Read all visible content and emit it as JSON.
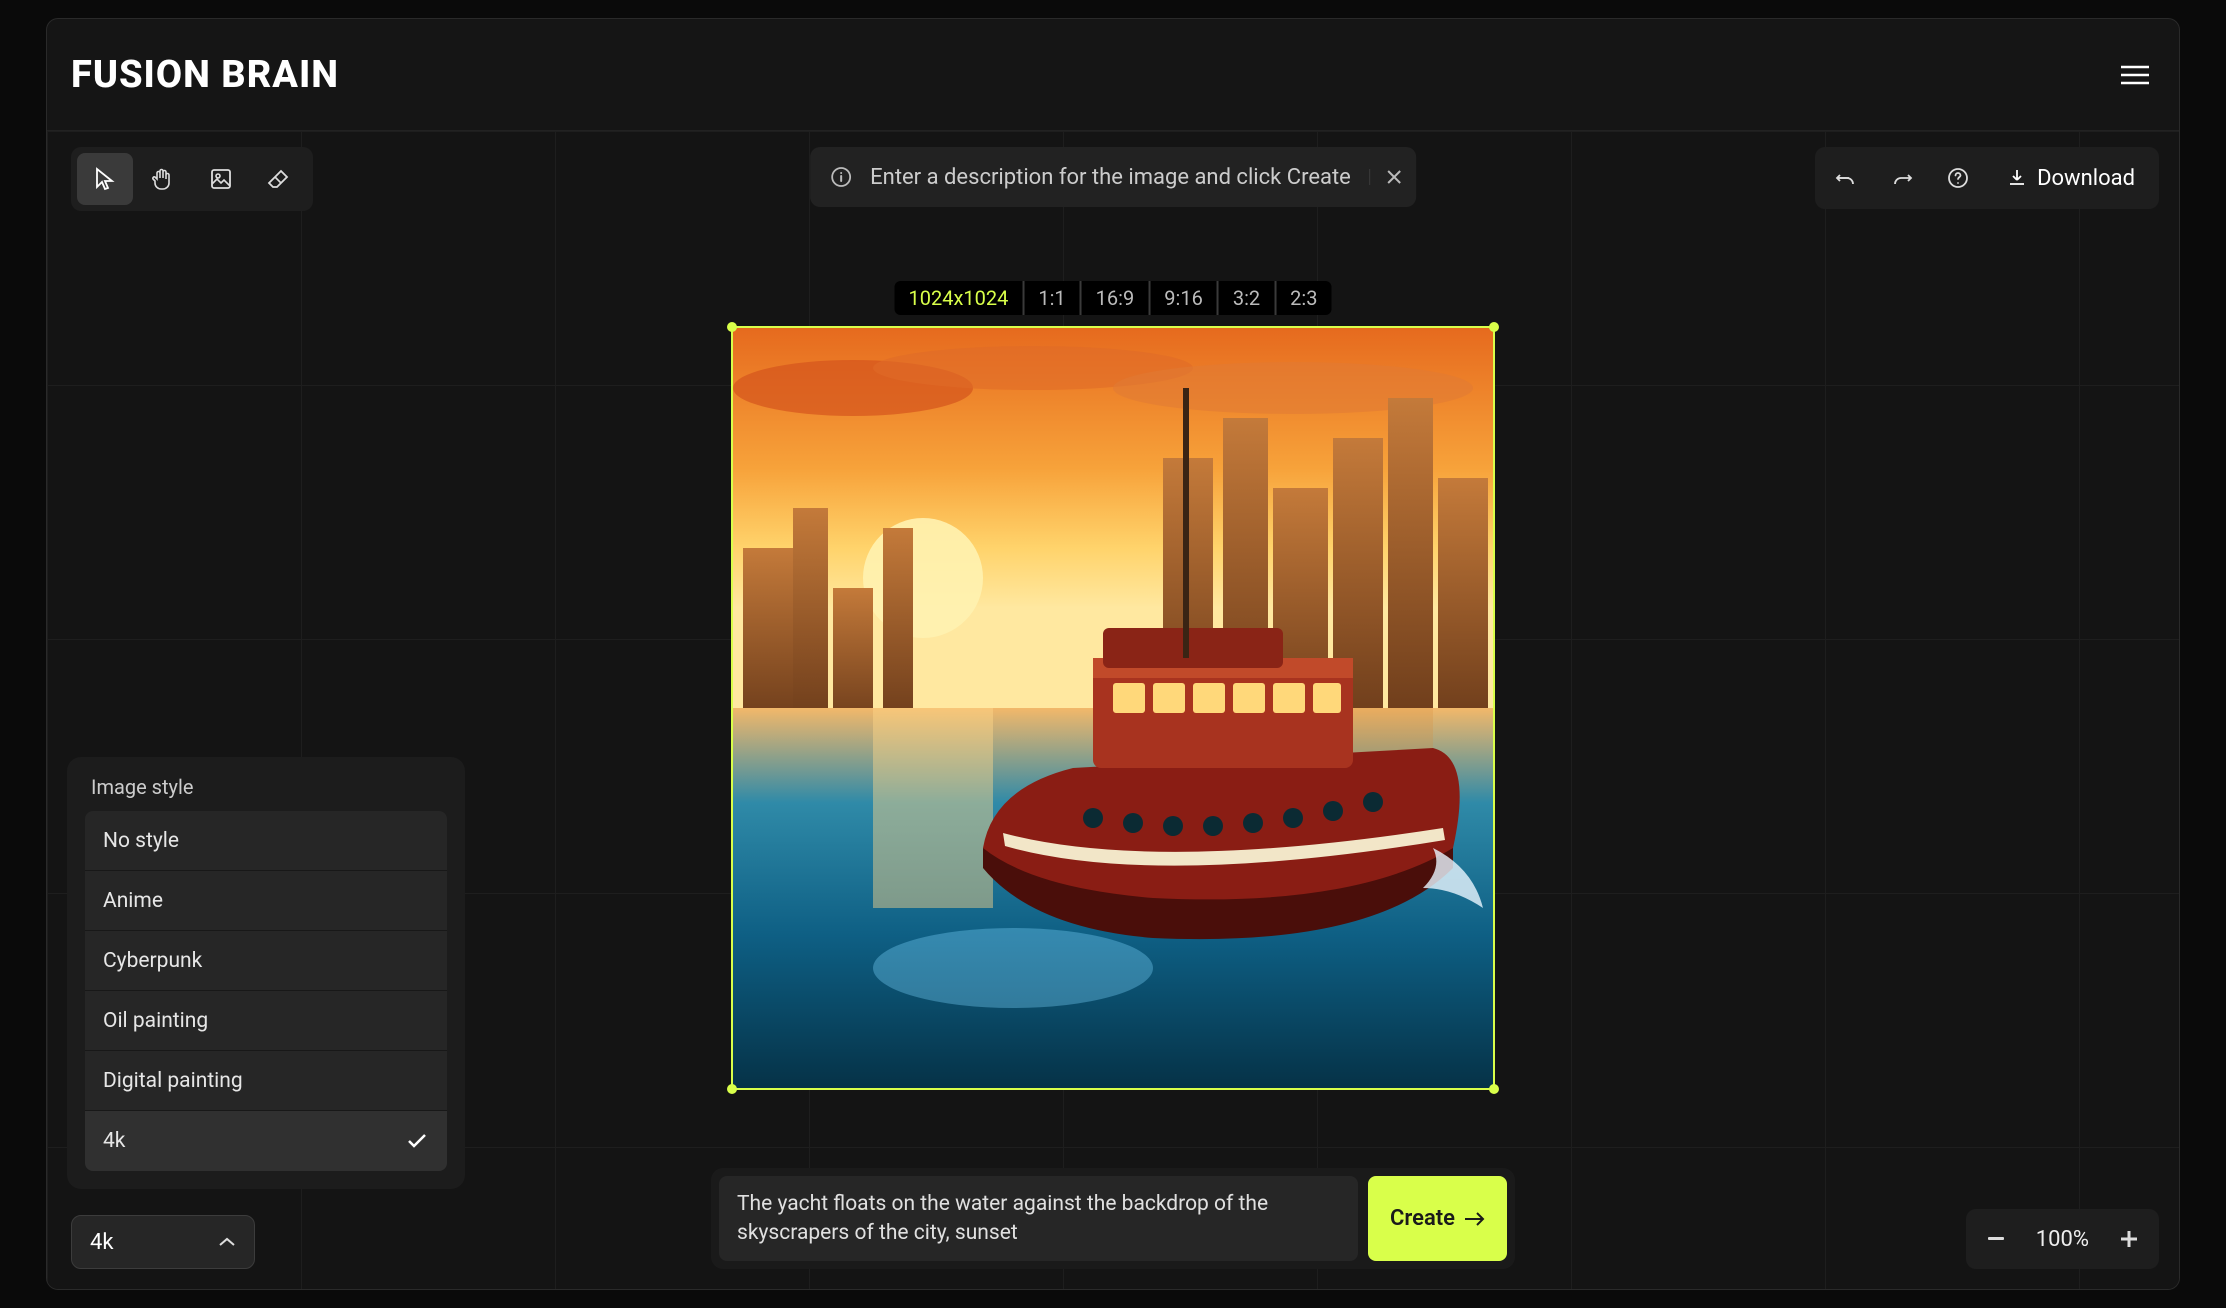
{
  "app": {
    "title": "FUSION BRAIN"
  },
  "hint": {
    "text": "Enter a description for the image and click Create"
  },
  "toolbar": {
    "download": "Download"
  },
  "ratios": {
    "size_label": "1024x1024",
    "options": [
      "1:1",
      "16:9",
      "9:16",
      "3:2",
      "2:3"
    ],
    "active_index": 0
  },
  "style_panel": {
    "title": "Image style",
    "items": [
      "No style",
      "Anime",
      "Cyberpunk",
      "Oil painting",
      "Digital painting",
      "4k"
    ],
    "selected_index": 5
  },
  "style_dropdown": {
    "value": "4k"
  },
  "prompt": {
    "value": "The yacht floats on the water against the backdrop of the skyscrapers of the city, sunset"
  },
  "create": {
    "label": "Create"
  },
  "zoom": {
    "value": "100%"
  },
  "colors": {
    "accent": "#d9ff4a"
  }
}
